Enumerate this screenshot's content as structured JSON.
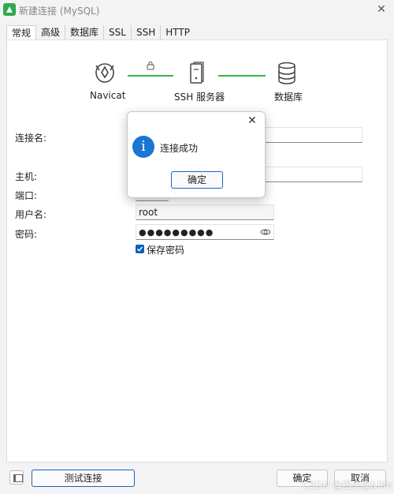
{
  "window": {
    "title": "新建连接 (MySQL)"
  },
  "tabs": [
    {
      "label": "常规",
      "active": true
    },
    {
      "label": "高级"
    },
    {
      "label": "数据库"
    },
    {
      "label": "SSL"
    },
    {
      "label": "SSH"
    },
    {
      "label": "HTTP"
    }
  ],
  "diagram": {
    "navicat_label": "Navicat",
    "ssh_label": "SSH 服务器",
    "db_label": "数据库",
    "line_color": "#37b34a"
  },
  "form": {
    "conn_name_label": "连接名:",
    "host_label": "主机:",
    "port_label": "端口:",
    "username_label": "用户名:",
    "username_value": "root",
    "password_label": "密码:",
    "password_mask": "●●●●●●●●●",
    "save_password_label": "保存密码",
    "save_password_checked": true
  },
  "dialog": {
    "message": "连接成功",
    "ok_label": "确定"
  },
  "footer": {
    "test_label": "测试连接",
    "ok_label": "确定",
    "cancel_label": "取消"
  },
  "watermark": "CSDN @扭头@&life",
  "colors": {
    "accent": "#1565c0",
    "info": "#1976d2",
    "check": "#0c62b8"
  }
}
